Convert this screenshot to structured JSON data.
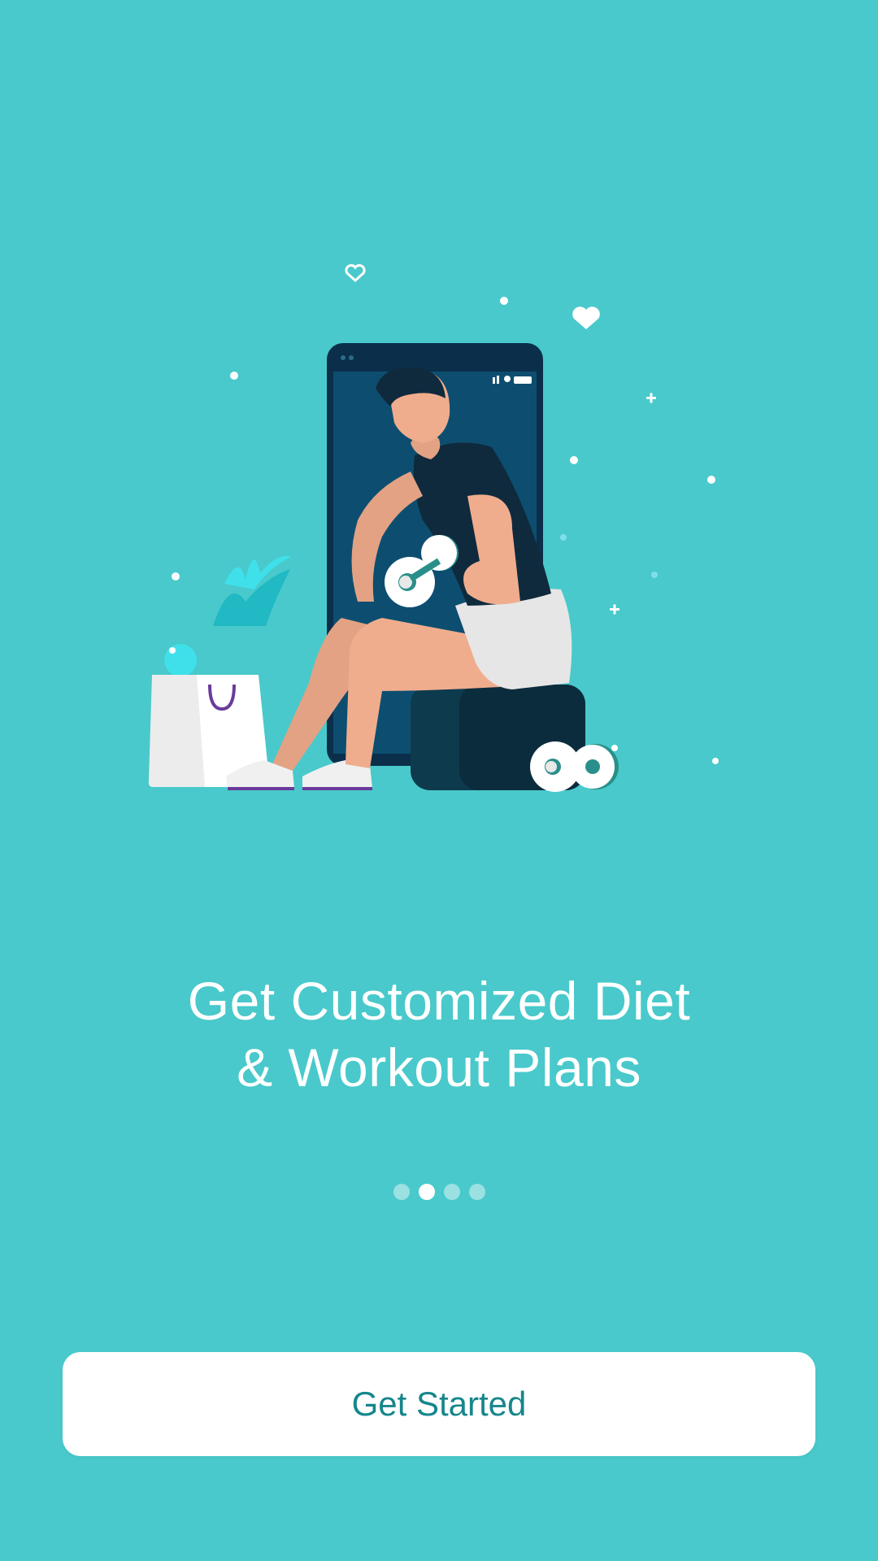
{
  "onboarding": {
    "headline_line1": "Get Customized Diet",
    "headline_line2": "& Workout Plans",
    "pager": {
      "total": 4,
      "active_index": 1
    },
    "cta_label": "Get Started"
  },
  "colors": {
    "background": "#49c9cb",
    "button_bg": "#ffffff",
    "button_text": "#16868c",
    "dot_active": "#ffffff",
    "dot_inactive": "rgba(255,255,255,0.45)"
  },
  "illustration": {
    "subject": "man-lifting-dumbbell-phone-illustration",
    "icons": [
      "heart-outline-icon",
      "heart-icon",
      "sparkle-icon",
      "shopping-bag-icon",
      "dumbbell-icon"
    ]
  }
}
